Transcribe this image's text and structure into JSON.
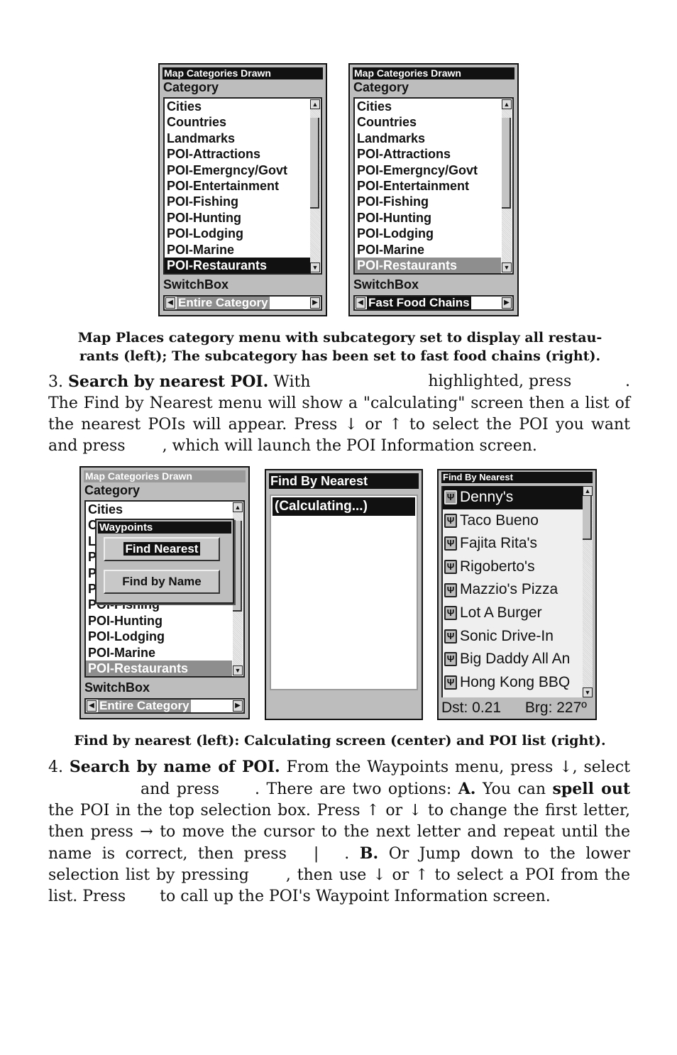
{
  "figure1": {
    "left_screen": {
      "title": "Map Categories Drawn",
      "category_label": "Category",
      "items": [
        "Cities",
        "Countries",
        "Landmarks",
        "POI-Attractions",
        "POI-Emergncy/Govt",
        "POI-Entertainment",
        "POI-Fishing",
        "POI-Hunting",
        "POI-Lodging",
        "POI-Marine",
        "POI-Restaurants"
      ],
      "selected_item": "POI-Restaurants",
      "switchbox_label": "SwitchBox",
      "switchbox_value": "Entire Category"
    },
    "right_screen": {
      "title": "Map Categories Drawn",
      "category_label": "Category",
      "items": [
        "Cities",
        "Countries",
        "Landmarks",
        "POI-Attractions",
        "POI-Emergncy/Govt",
        "POI-Entertainment",
        "POI-Fishing",
        "POI-Hunting",
        "POI-Lodging",
        "POI-Marine",
        "POI-Restaurants"
      ],
      "selected_item": "POI-Restaurants",
      "switchbox_label": "SwitchBox",
      "switchbox_value": "Fast Food Chains"
    },
    "caption_line1": "Map Places category menu with subcategory set to display all restau-",
    "caption_line2": "rants (left); The subcategory has been set to fast food chains (right)."
  },
  "step3": {
    "number": "3.",
    "heading": "Search by nearest POI.",
    "text_a": "With",
    "text_b": "highlighted, press",
    "text_c": ".",
    "text_d": "The Find by Nearest menu will show a \"calculating\" screen then a list of the nearest POIs will appear. Press ↓ or ↑ to select the POI you want and press",
    "text_e": ", which will launch the POI Information screen."
  },
  "figure2": {
    "left_screen": {
      "title": "Map Categories Drawn",
      "category_label": "Category",
      "items": [
        "Cities",
        "C",
        "L",
        "P",
        "P",
        "P",
        "POI-Fishing",
        "POI-Hunting",
        "POI-Lodging",
        "POI-Marine",
        "POI-Restaurants"
      ],
      "selected_item": "POI-Restaurants",
      "switchbox_label": "SwitchBox",
      "switchbox_value": "Entire Category",
      "popup": {
        "title": "Waypoints",
        "buttons": [
          "Find Nearest",
          "Find by Name"
        ],
        "active": "Find Nearest"
      }
    },
    "center_screen": {
      "title": "Find By Nearest",
      "status_row": "(Calculating...)"
    },
    "right_screen": {
      "title": "Find By Nearest",
      "items": [
        "Denny's",
        "Taco Bueno",
        "Fajita Rita's",
        "Rigoberto's",
        "Mazzio's Pizza",
        "Lot A Burger",
        "Sonic Drive-In",
        "Big Daddy All An",
        "Hong Kong BBQ"
      ],
      "selected_item": "Denny's",
      "icon": "restaurant-fork-icon",
      "distance_label": "Dst: 0.21",
      "bearing_label": "Brg: 227º"
    },
    "caption": "Find by nearest (left): Calculating screen (center) and POI list (right)."
  },
  "step4": {
    "number": "4.",
    "heading": "Search by name of POI.",
    "s1": "From the Waypoints menu, press ↓, select",
    "s2": "and press",
    "s3": ". There are two options:",
    "a_label": "A.",
    "s4": "You can",
    "spell_out": "spell out",
    "s5": "the POI in the top selection box. Press ↑ or ↓ to change the first letter, then press → to move the cursor to the next letter and repeat until the name is correct, then press",
    "s6": "|",
    "s7": ".",
    "b_label": "B.",
    "s8": "Or Jump down to the lower selection list by pressing",
    "s9": ", then use ↓ or ↑ to select a POI from the list. Press",
    "s10": "to call up the POI's Waypoint Information screen."
  }
}
